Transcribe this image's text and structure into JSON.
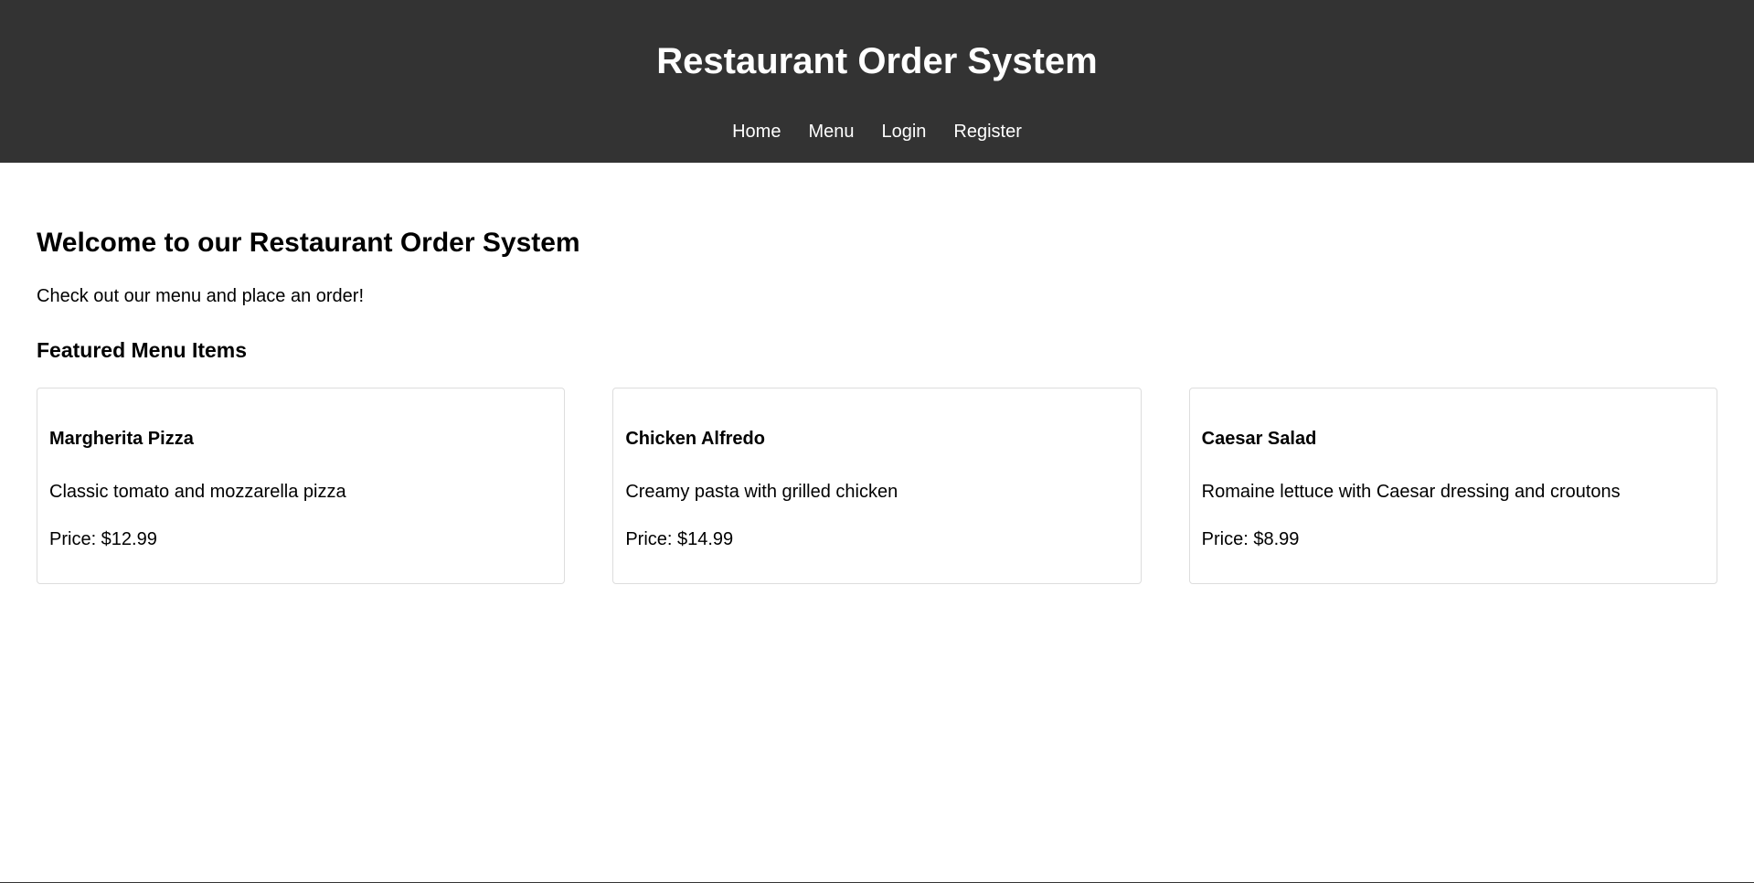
{
  "header": {
    "title": "Restaurant Order System",
    "nav": [
      {
        "label": "Home"
      },
      {
        "label": "Menu"
      },
      {
        "label": "Login"
      },
      {
        "label": "Register"
      }
    ]
  },
  "main": {
    "welcome_title": "Welcome to our Restaurant Order System",
    "intro_text": "Check out our menu and place an order!",
    "featured_title": "Featured Menu Items",
    "items": [
      {
        "name": "Margherita Pizza",
        "description": "Classic tomato and mozzarella pizza",
        "price": "Price: $12.99"
      },
      {
        "name": "Chicken Alfredo",
        "description": "Creamy pasta with grilled chicken",
        "price": "Price: $14.99"
      },
      {
        "name": "Caesar Salad",
        "description": "Romaine lettuce with Caesar dressing and croutons",
        "price": "Price: $8.99"
      }
    ]
  },
  "colors": {
    "header_bg": "#333333",
    "header_text": "#ffffff",
    "card_border": "#dddddd"
  }
}
